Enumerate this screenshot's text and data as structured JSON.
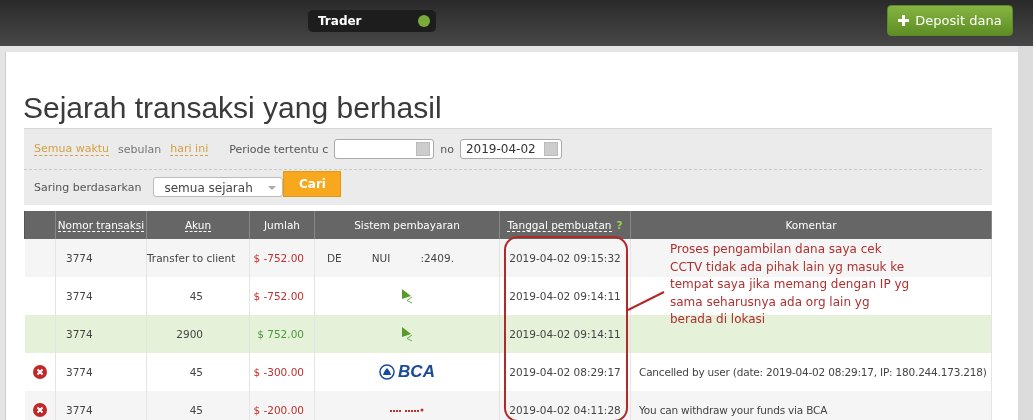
{
  "top_bar": {
    "account_select": "Trader",
    "deposit_button": "Deposit dana"
  },
  "title": "Sejarah transaksi yang berhasil",
  "filters": {
    "periods": [
      {
        "label": "Semua waktu",
        "selected": false
      },
      {
        "label": "sebulan",
        "selected": true
      },
      {
        "label": "hari ini",
        "selected": false
      }
    ],
    "range_label": "Periode tertentu c",
    "to_label": "no",
    "to": {
      "value": "2019-04-02"
    },
    "filter_label": "Saring berdasarkan",
    "filter_select": "semua sejarah",
    "search_button": "Cari"
  },
  "table": {
    "columns": [
      {},
      {
        "label": "Nomor transaksi",
        "sortable": true
      },
      {
        "label": "Akun",
        "sortable": true
      },
      {
        "label": "Jumlah",
        "sortable": false
      },
      {
        "label": "Sistem pembayaran",
        "sortable": false
      },
      {
        "label": "Tanggal pembuatan",
        "sortable": true,
        "help": "?"
      },
      {
        "label": "Komentar",
        "sortable": false
      }
    ],
    "rows": [
      {
        "cancelled": false,
        "credit": false,
        "number": "3774",
        "account": "Transfer to client",
        "amount": "$ -752.00",
        "payment": {
          "kind": "text",
          "parts": [
            "DE",
            "NUI",
            ":2409."
          ]
        },
        "date": "2019-04-02 09:15:32"
      },
      {
        "cancelled": false,
        "credit": false,
        "number": "3774",
        "account": "45",
        "amount": "$ -752.00",
        "payment": {
          "kind": "arrow-logo"
        },
        "date": "2019-04-02 09:14:11"
      },
      {
        "cancelled": false,
        "credit": true,
        "number": "3774",
        "account": "2900",
        "amount": "$ 752.00",
        "payment": {
          "kind": "arrow-logo"
        },
        "date": "2019-04-02 09:14:11"
      },
      {
        "cancelled": true,
        "credit": false,
        "number": "3774",
        "account": "45",
        "amount": "$ -300.00",
        "payment": {
          "kind": "bca-logo",
          "text": "BCA"
        },
        "date": "2019-04-02 08:29:17",
        "comment": "Cancelled by user (date: 2019-04-02 08:29:17, IP: 180.244.173.218)"
      },
      {
        "cancelled": true,
        "credit": false,
        "number": "3774",
        "account": "45",
        "amount": "$ -200.00",
        "payment": {
          "kind": "pm-logo"
        },
        "date": "2019-04-02 04:11:28",
        "comment": "You can withdraw your funds via BCA"
      }
    ]
  },
  "annotation": {
    "lines": [
      "Proses pengambilan dana saya cek",
      "CCTV tidak ada pihak lain yg masuk ke",
      "tempat saya jika memang dengan IP yg",
      "sama seharusnya  ada org lain yg",
      "berada di lokasi"
    ]
  }
}
